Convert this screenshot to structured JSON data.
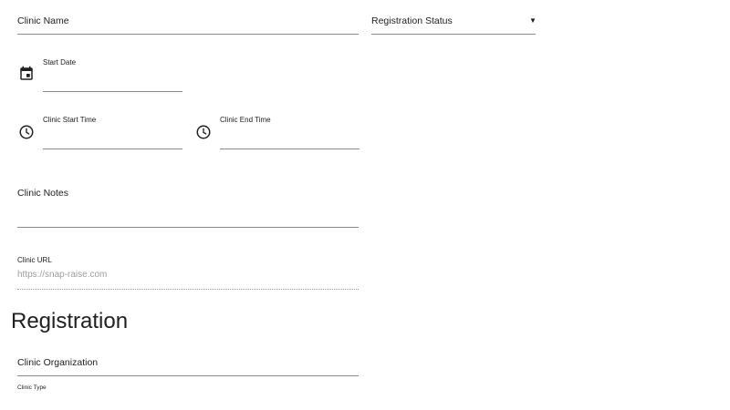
{
  "form": {
    "clinic_name": {
      "placeholder": "Clinic Name",
      "value": ""
    },
    "registration_status": {
      "placeholder": "Registration Status",
      "value": "",
      "caret_icon": "triangle-down-icon"
    },
    "start_date": {
      "label": "Start Date",
      "value": "",
      "icon": "calendar-icon"
    },
    "clinic_start_time": {
      "label": "Clinic Start Time",
      "value": "",
      "icon": "clock-icon"
    },
    "clinic_end_time": {
      "label": "Clinic End Time",
      "value": "",
      "icon": "clock-icon"
    },
    "clinic_notes": {
      "placeholder": "Clinic Notes",
      "value": ""
    },
    "clinic_url": {
      "label": "Clinic URL",
      "value": "https://snap-raise.com"
    }
  },
  "registration": {
    "title": "Registration",
    "clinic_organization": {
      "placeholder": "Clinic Organization",
      "value": ""
    },
    "clinic_type": {
      "label": "Clinic Type"
    }
  }
}
